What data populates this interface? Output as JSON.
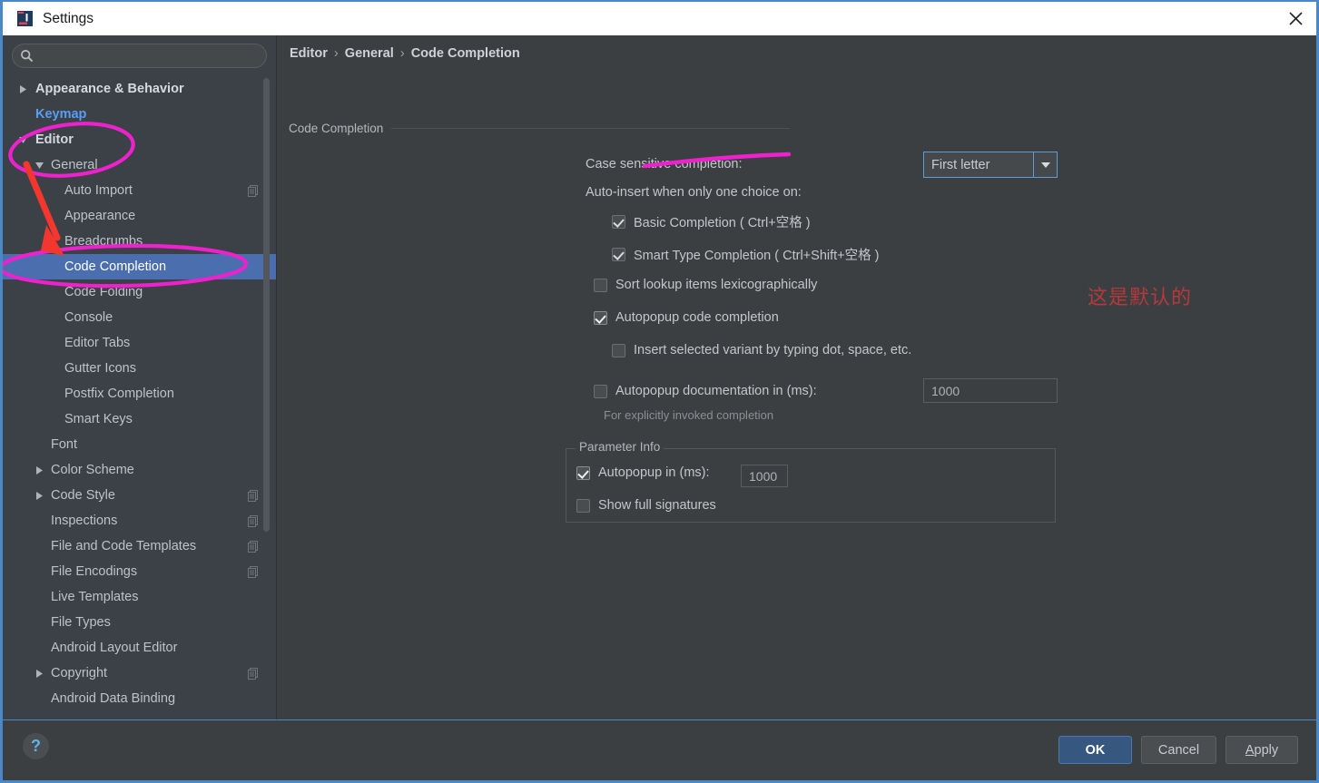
{
  "window": {
    "title": "Settings",
    "app_icon": "intellij-idea-icon",
    "close_icon": "close-icon"
  },
  "search": {
    "placeholder": "",
    "value": "",
    "icon": "search-icon"
  },
  "sidebar": {
    "items": [
      {
        "label": "Appearance & Behavior",
        "level": 0,
        "arrow": "right",
        "bold": true,
        "badge": false,
        "selected": false
      },
      {
        "label": "Keymap",
        "level": 0,
        "arrow": "none",
        "link": true,
        "badge": false,
        "selected": false
      },
      {
        "label": "Editor",
        "level": 0,
        "arrow": "down",
        "bold": true,
        "badge": false,
        "selected": false
      },
      {
        "label": "General",
        "level": 1,
        "arrow": "down",
        "badge": false,
        "selected": false
      },
      {
        "label": "Auto Import",
        "level": 2,
        "arrow": "none",
        "badge": true,
        "selected": false
      },
      {
        "label": "Appearance",
        "level": 2,
        "arrow": "none",
        "badge": false,
        "selected": false
      },
      {
        "label": "Breadcrumbs",
        "level": 2,
        "arrow": "none",
        "badge": false,
        "selected": false
      },
      {
        "label": "Code Completion",
        "level": 2,
        "arrow": "none",
        "badge": false,
        "selected": true
      },
      {
        "label": "Code Folding",
        "level": 2,
        "arrow": "none",
        "badge": false,
        "selected": false
      },
      {
        "label": "Console",
        "level": 2,
        "arrow": "none",
        "badge": false,
        "selected": false
      },
      {
        "label": "Editor Tabs",
        "level": 2,
        "arrow": "none",
        "badge": false,
        "selected": false
      },
      {
        "label": "Gutter Icons",
        "level": 2,
        "arrow": "none",
        "badge": false,
        "selected": false
      },
      {
        "label": "Postfix Completion",
        "level": 2,
        "arrow": "none",
        "badge": false,
        "selected": false
      },
      {
        "label": "Smart Keys",
        "level": 2,
        "arrow": "none",
        "badge": false,
        "selected": false
      },
      {
        "label": "Font",
        "level": 1,
        "arrow": "none",
        "badge": false,
        "selected": false
      },
      {
        "label": "Color Scheme",
        "level": 1,
        "arrow": "right",
        "badge": false,
        "selected": false
      },
      {
        "label": "Code Style",
        "level": 1,
        "arrow": "right",
        "badge": true,
        "selected": false
      },
      {
        "label": "Inspections",
        "level": 1,
        "arrow": "none",
        "badge": true,
        "selected": false
      },
      {
        "label": "File and Code Templates",
        "level": 1,
        "arrow": "none",
        "badge": true,
        "selected": false
      },
      {
        "label": "File Encodings",
        "level": 1,
        "arrow": "none",
        "badge": true,
        "selected": false
      },
      {
        "label": "Live Templates",
        "level": 1,
        "arrow": "none",
        "badge": false,
        "selected": false
      },
      {
        "label": "File Types",
        "level": 1,
        "arrow": "none",
        "badge": false,
        "selected": false
      },
      {
        "label": "Android Layout Editor",
        "level": 1,
        "arrow": "none",
        "badge": false,
        "selected": false
      },
      {
        "label": "Copyright",
        "level": 1,
        "arrow": "right",
        "badge": true,
        "selected": false
      },
      {
        "label": "Android Data Binding",
        "level": 1,
        "arrow": "none",
        "badge": false,
        "selected": false
      }
    ]
  },
  "main": {
    "breadcrumb": {
      "part1": "Editor",
      "sep1": "›",
      "part2": "General",
      "sep2": "›",
      "part3": "Code Completion"
    },
    "group_title": "Code Completion",
    "case_sensitive_label": "Case sensitive completion:",
    "case_sensitive_value": "First letter",
    "auto_insert_label": "Auto-insert when only one choice on:",
    "checkboxes": {
      "basic_completion": {
        "label": "Basic Completion ( Ctrl+空格 )",
        "checked": true,
        "enabled": false
      },
      "smart_type_completion": {
        "label": "Smart Type Completion ( Ctrl+Shift+空格 )",
        "checked": true,
        "enabled": false
      },
      "sort_lookup": {
        "label": "Sort lookup items lexicographically",
        "checked": false,
        "enabled": true
      },
      "autopopup_code": {
        "label": "Autopopup code completion",
        "checked": true,
        "enabled": true
      },
      "insert_selected": {
        "label": "Insert selected variant by typing dot, space, etc.",
        "checked": false,
        "enabled": false
      },
      "autopopup_doc": {
        "label": "Autopopup documentation in (ms):",
        "checked": false,
        "enabled": true
      }
    },
    "autopopup_doc_value": "1000",
    "autopopup_doc_hint": "For explicitly invoked completion",
    "parameter_info": {
      "legend": "Parameter Info",
      "autopopup_label": "Autopopup in (ms):",
      "autopopup_checked": true,
      "autopopup_value": "1000",
      "show_full_signatures_label": "Show full signatures",
      "show_full_signatures_checked": false
    }
  },
  "annotations": {
    "chinese_note": "这是默认的",
    "note_color": "#b5393c",
    "highlight_color": "#ee22cc",
    "arrow_color": "#f4372e"
  },
  "footer": {
    "help_icon": "question-mark-icon",
    "help_label": "?",
    "ok_label": "OK",
    "cancel_label": "Cancel",
    "apply_label_u": "A",
    "apply_label_rest": "pply"
  },
  "colors": {
    "window_bg": "#3c3f41",
    "sidebar_bg": "#3c4047",
    "selection_blue": "#4b6eaf",
    "accent_blue": "#4a88c7",
    "link_blue": "#589df6"
  }
}
